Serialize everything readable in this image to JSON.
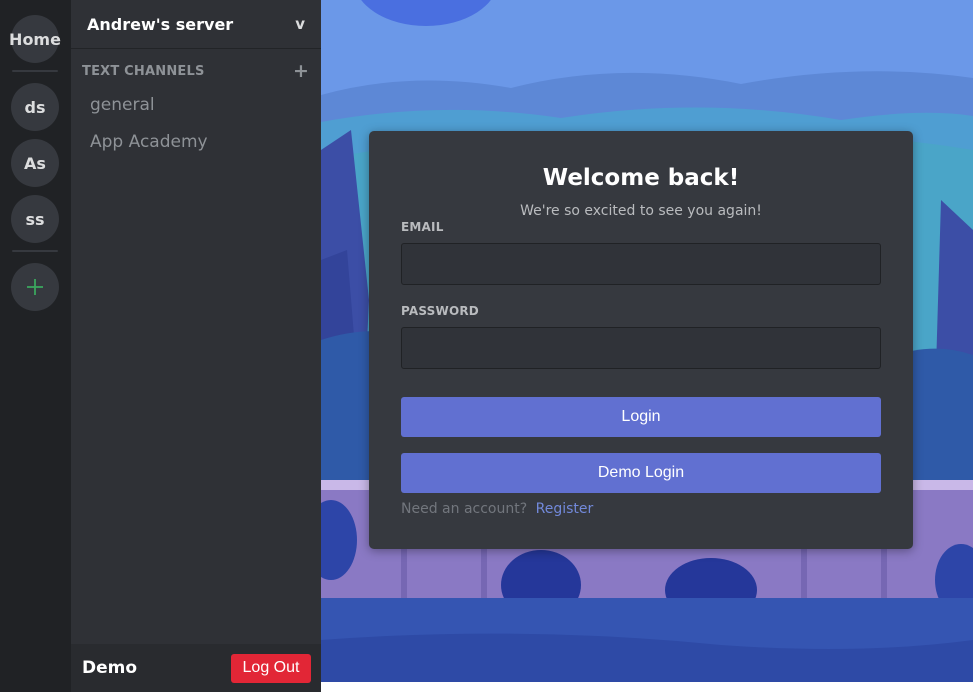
{
  "colors": {
    "accent": "#6170d1",
    "link": "#7289da",
    "danger": "#e22636",
    "add_green": "#3ba55d"
  },
  "server_rail": {
    "home_label": "Home",
    "servers": [
      {
        "label": "ds"
      },
      {
        "label": "As"
      },
      {
        "label": "ss"
      }
    ],
    "add_server_icon": "plus-icon"
  },
  "sidebar": {
    "server_name": "Andrew's server",
    "server_menu_glyph": "v",
    "channels_heading": "TEXT CHANNELS",
    "add_channel_icon": "plus-icon",
    "channels": [
      {
        "name": "general"
      },
      {
        "name": "App Academy"
      }
    ]
  },
  "user_panel": {
    "username": "Demo",
    "logout_label": "Log Out"
  },
  "login": {
    "title": "Welcome back!",
    "subtitle": "We're so excited to see you again!",
    "email_label": "EMAIL",
    "email_value": "",
    "password_label": "PASSWORD",
    "password_value": "",
    "login_label": "Login",
    "demo_login_label": "Demo Login",
    "register_prompt": "Need an account?",
    "register_link": "Register"
  }
}
